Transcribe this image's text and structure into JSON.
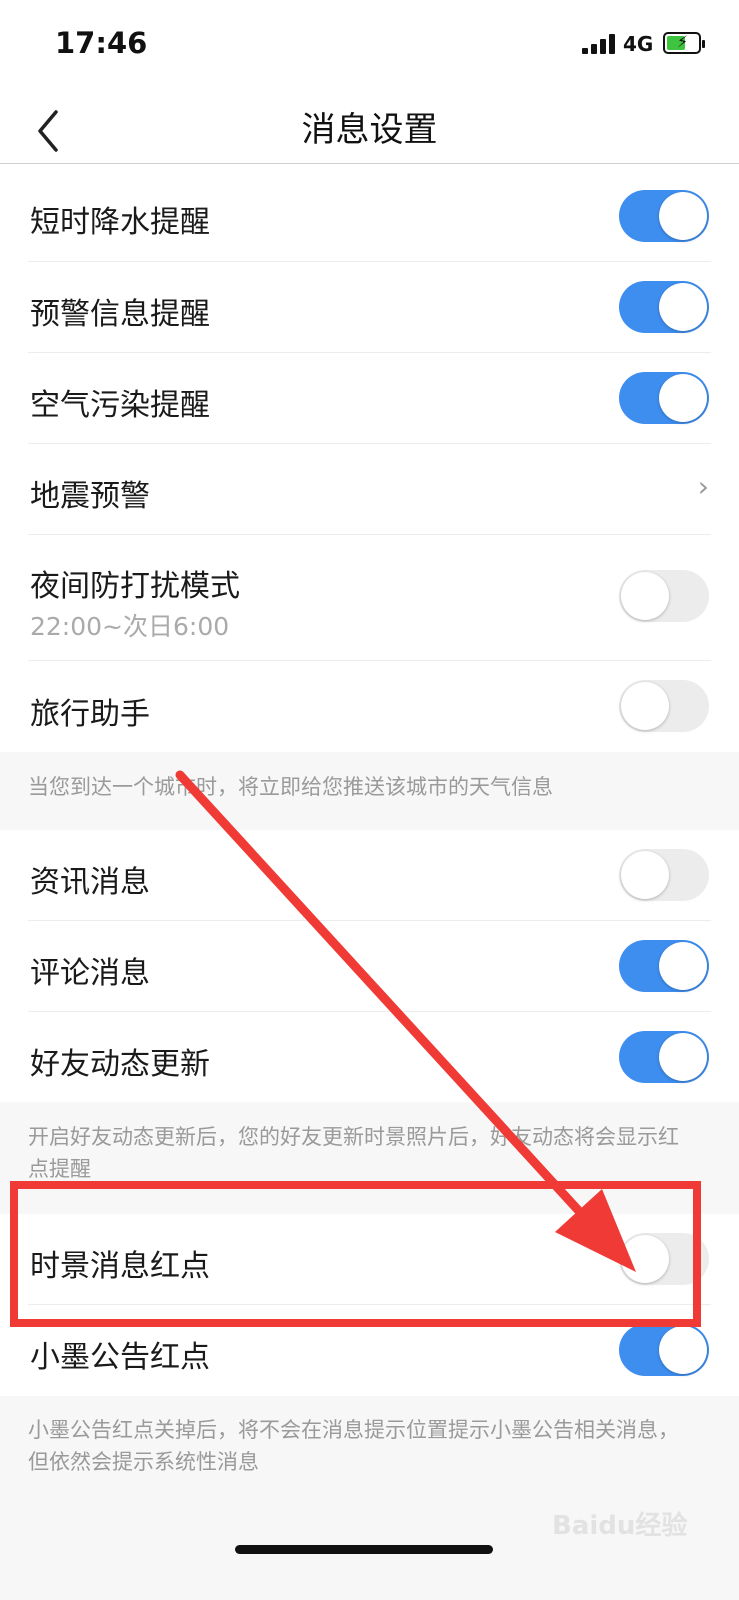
{
  "status": {
    "time": "17:46",
    "network": "4G"
  },
  "nav": {
    "title": "消息设置"
  },
  "rows": {
    "rain": {
      "label": "短时降水提醒",
      "on": true
    },
    "warning": {
      "label": "预警信息提醒",
      "on": true
    },
    "air": {
      "label": "空气污染提醒",
      "on": true
    },
    "quake": {
      "label": "地震预警"
    },
    "night": {
      "label": "夜间防打扰模式",
      "sub": "22:00~次日6:00",
      "on": false
    },
    "travel": {
      "label": "旅行助手",
      "on": false
    },
    "news": {
      "label": "资讯消息",
      "on": false
    },
    "comment": {
      "label": "评论消息",
      "on": true
    },
    "friends": {
      "label": "好友动态更新",
      "on": true
    },
    "scene": {
      "label": "时景消息红点",
      "on": false
    },
    "notice": {
      "label": "小墨公告红点",
      "on": true
    }
  },
  "notes": {
    "travel": "当您到达一个城市时，将立即给您推送该城市的天气信息",
    "friends": "开启好友动态更新后，您的好友更新时景照片后，好友动态将会显示红点提醒",
    "notice": "小墨公告红点关掉后，将不会在消息提示位置提示小墨公告相关消息，但依然会提示系统性消息"
  },
  "colors": {
    "toggle_on": "#3e8ef0",
    "toggle_off": "#ececec",
    "annotation": "#f03a35"
  },
  "icons": {
    "back": "chevron-left-icon",
    "chevron": "chevron-right-icon"
  },
  "watermark": "Baidu经验"
}
